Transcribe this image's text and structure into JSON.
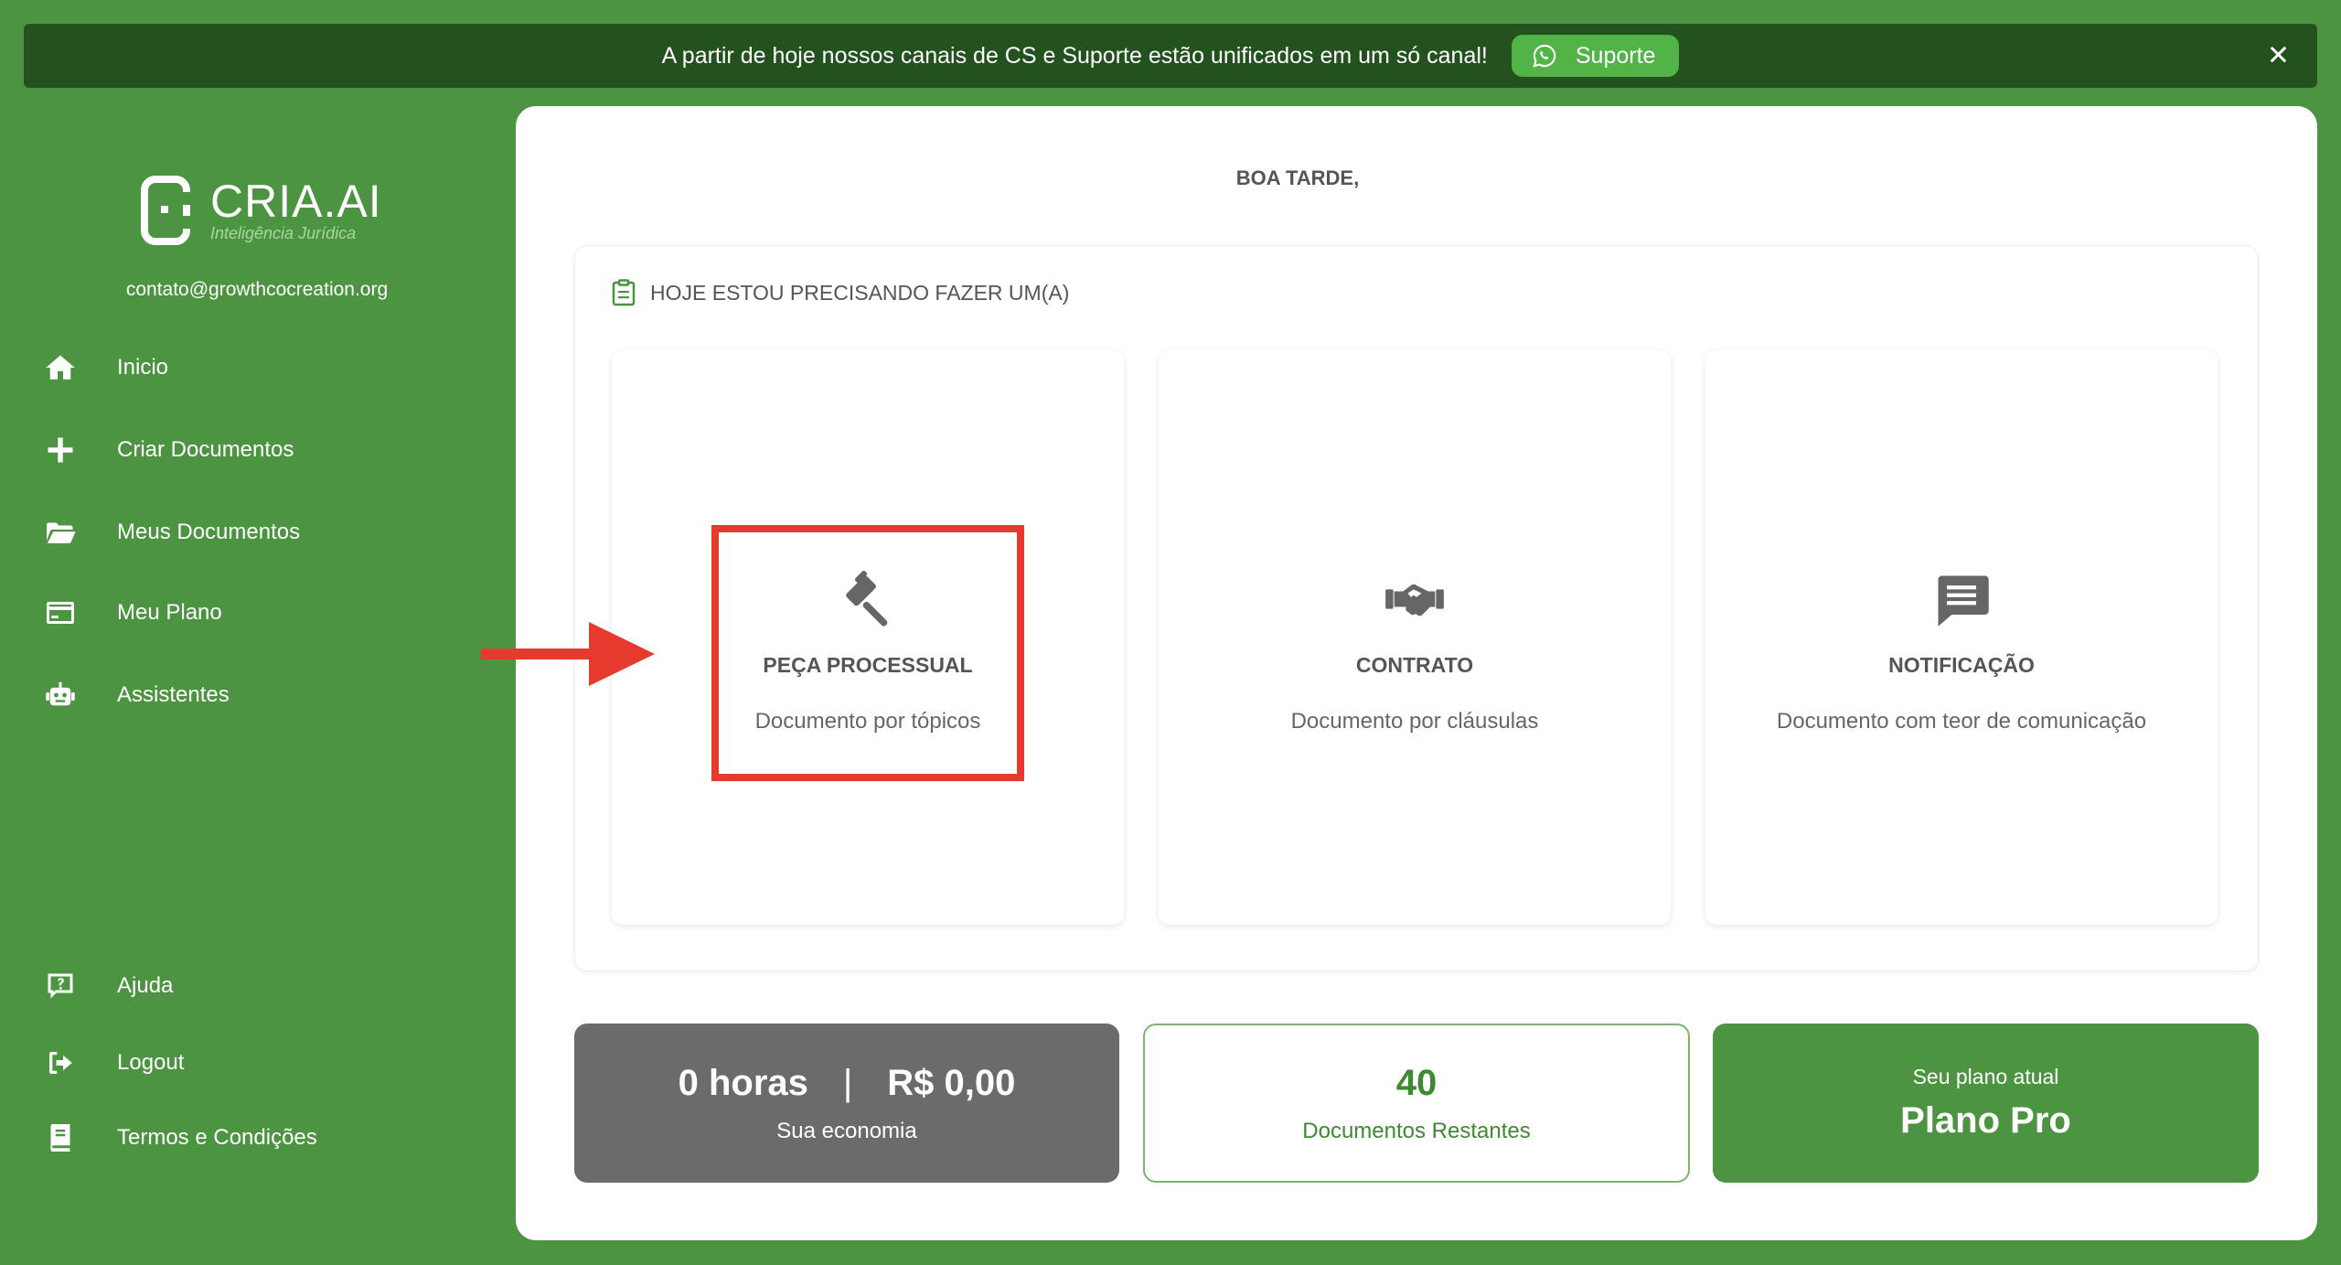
{
  "banner": {
    "message": "A partir de hoje nossos canais de CS e Suporte estão unificados em um só canal!",
    "support_label": "Suporte",
    "close_symbol": "✕"
  },
  "brand": {
    "name": "CRIA.AI",
    "tagline": "Inteligência Jurídica"
  },
  "user": {
    "email": "contato@growthcocreation.org"
  },
  "nav": {
    "inicio": "Inicio",
    "criar": "Criar Documentos",
    "meus": "Meus Documentos",
    "plano": "Meu Plano",
    "assistentes": "Assistentes",
    "ajuda": "Ajuda",
    "logout": "Logout",
    "termos": "Termos e Condições"
  },
  "main": {
    "greeting": "BOA TARDE,",
    "section_title": "HOJE ESTOU PRECISANDO FAZER UM(A)",
    "cards": [
      {
        "title": "PEÇA PROCESSUAL",
        "subtitle": "Documento por tópicos",
        "icon": "gavel-icon"
      },
      {
        "title": "CONTRATO",
        "subtitle": "Documento por cláusulas",
        "icon": "handshake-icon"
      },
      {
        "title": "NOTIFICAÇÃO",
        "subtitle": "Documento com teor de comunicação",
        "icon": "message-icon"
      }
    ]
  },
  "stats": {
    "hours": "0 horas",
    "separator": "|",
    "money": "R$ 0,00",
    "savings_caption": "Sua economia",
    "docs_count": "40",
    "docs_caption": "Documentos Restantes",
    "plan_caption": "Seu plano atual",
    "plan_name": "Plano Pro"
  },
  "colors": {
    "sidebar_green": "#4c9441",
    "banner_dark": "#24521f",
    "support_green": "#52b347",
    "highlight_red": "#e53a2d",
    "savings_gray": "#6b6b6b"
  }
}
